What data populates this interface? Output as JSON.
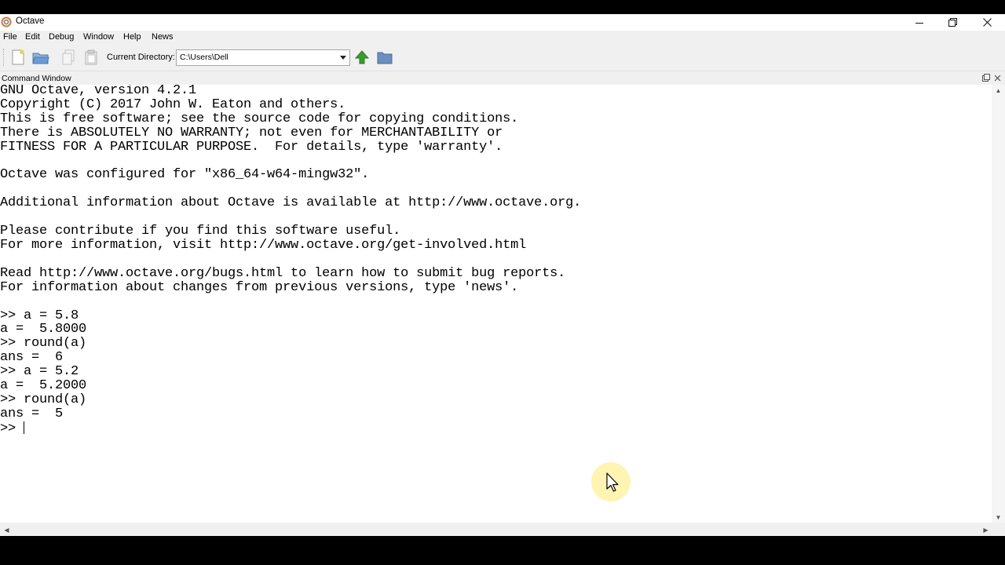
{
  "window": {
    "title": "Octave"
  },
  "menu": [
    "File",
    "Edit",
    "Debug",
    "Window",
    "Help",
    "News"
  ],
  "toolbar": {
    "dir_label": "Current Directory:",
    "dir_value": "C:\\Users\\Dell"
  },
  "panel": {
    "title": "Command Window"
  },
  "console": {
    "lines": [
      "GNU Octave, version 4.2.1",
      "Copyright (C) 2017 John W. Eaton and others.",
      "This is free software; see the source code for copying conditions.",
      "There is ABSOLUTELY NO WARRANTY; not even for MERCHANTABILITY or",
      "FITNESS FOR A PARTICULAR PURPOSE.  For details, type 'warranty'.",
      "",
      "Octave was configured for \"x86_64-w64-mingw32\".",
      "",
      "Additional information about Octave is available at http://www.octave.org.",
      "",
      "Please contribute if you find this software useful.",
      "For more information, visit http://www.octave.org/get-involved.html",
      "",
      "Read http://www.octave.org/bugs.html to learn how to submit bug reports.",
      "For information about changes from previous versions, type 'news'.",
      "",
      ">> a = 5.8",
      "a =  5.8000",
      ">> round(a)",
      "ans =  6",
      ">> a = 5.2",
      "a =  5.2000",
      ">> round(a)",
      "ans =  5"
    ],
    "prompt": ">> "
  },
  "colors": {
    "accent_green": "#3c9a2f",
    "folder_blue": "#6b8fbf",
    "cursor_highlight": "#fff3a8"
  },
  "icons": [
    "new-file-icon",
    "open-folder-icon",
    "copy-icon",
    "paste-icon",
    "up-directory-icon",
    "browse-folder-icon",
    "mouse-pointer-icon"
  ]
}
